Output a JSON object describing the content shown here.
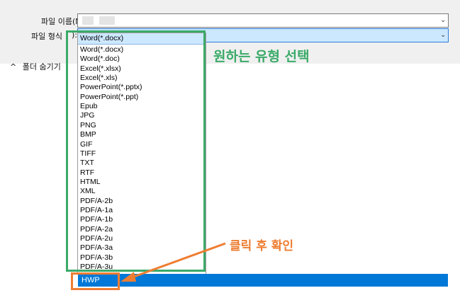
{
  "dialog": {
    "filename_label": "파일 이름(N):",
    "filetype_label": "파일 형식",
    "filetype_label_partial": "):",
    "selected_type": "Word(*.docx)",
    "collapse_label": "폴더 숨기기"
  },
  "dropdown": {
    "items": [
      "Word(*.docx)",
      "Word(*.doc)",
      "Excel(*.xlsx)",
      "Excel(*.xls)",
      "PowerPoint(*.pptx)",
      "PowerPoint(*.ppt)",
      "Epub",
      "JPG",
      "PNG",
      "BMP",
      "GIF",
      "TIFF",
      "TXT",
      "RTF",
      "HTML",
      "XML",
      "PDF/A-2b",
      "PDF/A-1a",
      "PDF/A-1b",
      "PDF/A-2a",
      "PDF/A-2u",
      "PDF/A-3a",
      "PDF/A-3b",
      "PDF/A-3u"
    ],
    "highlighted_item": "HWP"
  },
  "annotations": {
    "choose_type": "원하는 유형 선택",
    "click_confirm": "클릭 후 확인"
  },
  "colors": {
    "annotation_green": "#3aaa68",
    "annotation_orange": "#ee7d31",
    "selection_blue": "#0078d7"
  }
}
